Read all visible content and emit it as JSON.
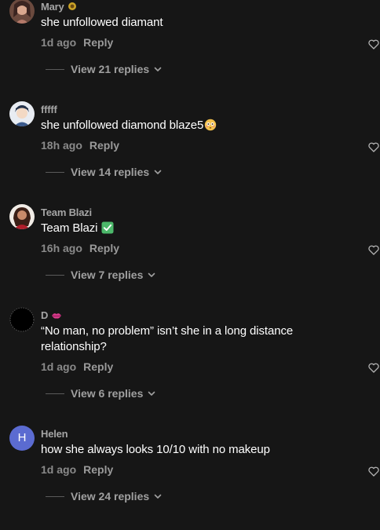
{
  "comments": [
    {
      "username": "Mary",
      "badge": "sunflower-emoji",
      "text": "she unfollowed diamant",
      "time": "1d ago",
      "reply_label": "Reply",
      "replies_label": "View 21 replies"
    },
    {
      "username": "fffff",
      "text": "she unfollowed diamond blaze5",
      "emoji": "flushed-face-emoji",
      "time": "18h ago",
      "reply_label": "Reply",
      "replies_label": "View 14 replies"
    },
    {
      "username": "Team Blazi",
      "text": "Team Blazi",
      "emoji": "green-check-emoji",
      "time": "16h ago",
      "reply_label": "Reply",
      "replies_label": "View 7 replies"
    },
    {
      "username": "D",
      "badge": "lips-emoji",
      "text_line1": "“No man, no problem” isn’t she in a long distance",
      "text_line2": "relationship?",
      "time": "1d ago",
      "reply_label": "Reply",
      "replies_label": "View 6 replies"
    },
    {
      "username": "Helen",
      "avatar_letter": "H",
      "avatar_color": "#5b6bd1",
      "text": "how she always looks 10/10 with no makeup",
      "time": "1d ago",
      "reply_label": "Reply",
      "replies_label": "View 24 replies"
    }
  ],
  "colors": {
    "background": "#161616",
    "username": "#a5a5a5",
    "meta": "#8a8a8a",
    "body": "#ffffff"
  }
}
